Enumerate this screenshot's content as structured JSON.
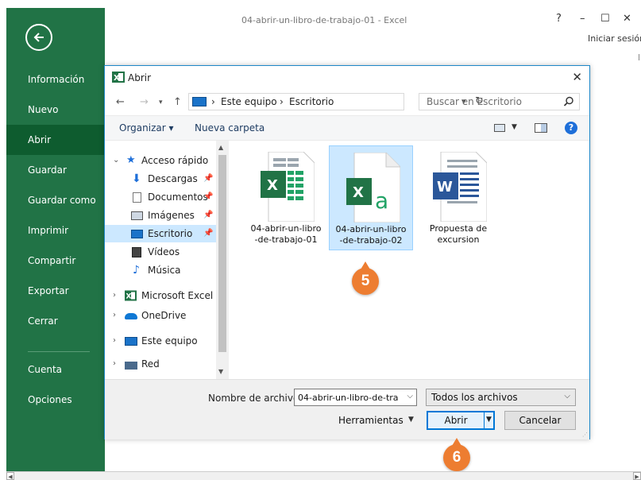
{
  "window": {
    "title": "04-abrir-un-libro-de-trabajo-01 - Excel",
    "help_glyph": "?",
    "minimize_glyph": "–",
    "maximize_glyph": "☐",
    "close_glyph": "✕",
    "signin_label": "Iniciar sesión"
  },
  "backstage": {
    "accent_color": "#217346",
    "active_color": "#0e5c2f",
    "items": [
      {
        "label": "Información"
      },
      {
        "label": "Nuevo"
      },
      {
        "label": "Abrir",
        "active": true
      },
      {
        "label": "Guardar"
      },
      {
        "label": "Guardar como"
      },
      {
        "label": "Imprimir"
      },
      {
        "label": "Compartir"
      },
      {
        "label": "Exportar"
      },
      {
        "label": "Cerrar"
      },
      {
        "label": "Cuenta"
      },
      {
        "label": "Opciones"
      }
    ]
  },
  "dialog": {
    "title": "Abrir",
    "close_glyph": "✕",
    "address": {
      "crumbs": [
        "Este equipo",
        "Escritorio"
      ],
      "separator": "›"
    },
    "search": {
      "placeholder": "Buscar en Escritorio"
    },
    "toolbar": {
      "organize_label": "Organizar ▾",
      "new_folder_label": "Nueva carpeta",
      "help_glyph": "?"
    },
    "tree": [
      {
        "label": "Acceso rápido",
        "icon": "star-icon",
        "chevron": "expanded"
      },
      {
        "label": "Descargas",
        "icon": "download-icon",
        "pinned": true
      },
      {
        "label": "Documentos",
        "icon": "documents-icon",
        "pinned": true
      },
      {
        "label": "Imágenes",
        "icon": "pictures-icon",
        "pinned": true
      },
      {
        "label": "Escritorio",
        "icon": "desktop-icon",
        "pinned": true,
        "selected": true
      },
      {
        "label": "Vídeos",
        "icon": "videos-icon"
      },
      {
        "label": "Música",
        "icon": "music-icon"
      },
      {
        "label": "Microsoft Excel",
        "icon": "excel-icon",
        "chevron": "collapsed"
      },
      {
        "label": "OneDrive",
        "icon": "onedrive-icon",
        "chevron": "collapsed"
      },
      {
        "label": "Este equipo",
        "icon": "computer-icon",
        "chevron": "collapsed"
      },
      {
        "label": "Red",
        "icon": "network-icon",
        "chevron": "collapsed"
      }
    ],
    "files": [
      {
        "name_line1": "04-abrir-un-libro",
        "name_line2": "-de-trabajo-01",
        "type": "excel-workbook"
      },
      {
        "name_line1": "04-abrir-un-libro",
        "name_line2": "-de-trabajo-02",
        "type": "excel-template",
        "selected": true
      },
      {
        "name_line1": "Propuesta de",
        "name_line2": "excursion",
        "type": "word-document"
      }
    ],
    "filename_label": "Nombre de archivo:",
    "filename_value": "04-abrir-un-libro-de-tra",
    "filetype_value": "Todos los archivos",
    "tools_label": "Herramientas",
    "open_label": "Abrir",
    "cancel_label": "Cancelar"
  },
  "callouts": [
    "5",
    "6"
  ],
  "colors": {
    "excel_green": "#217346",
    "word_blue": "#2b579a",
    "selection": "#cce8ff",
    "callout": "#ed7d31"
  }
}
